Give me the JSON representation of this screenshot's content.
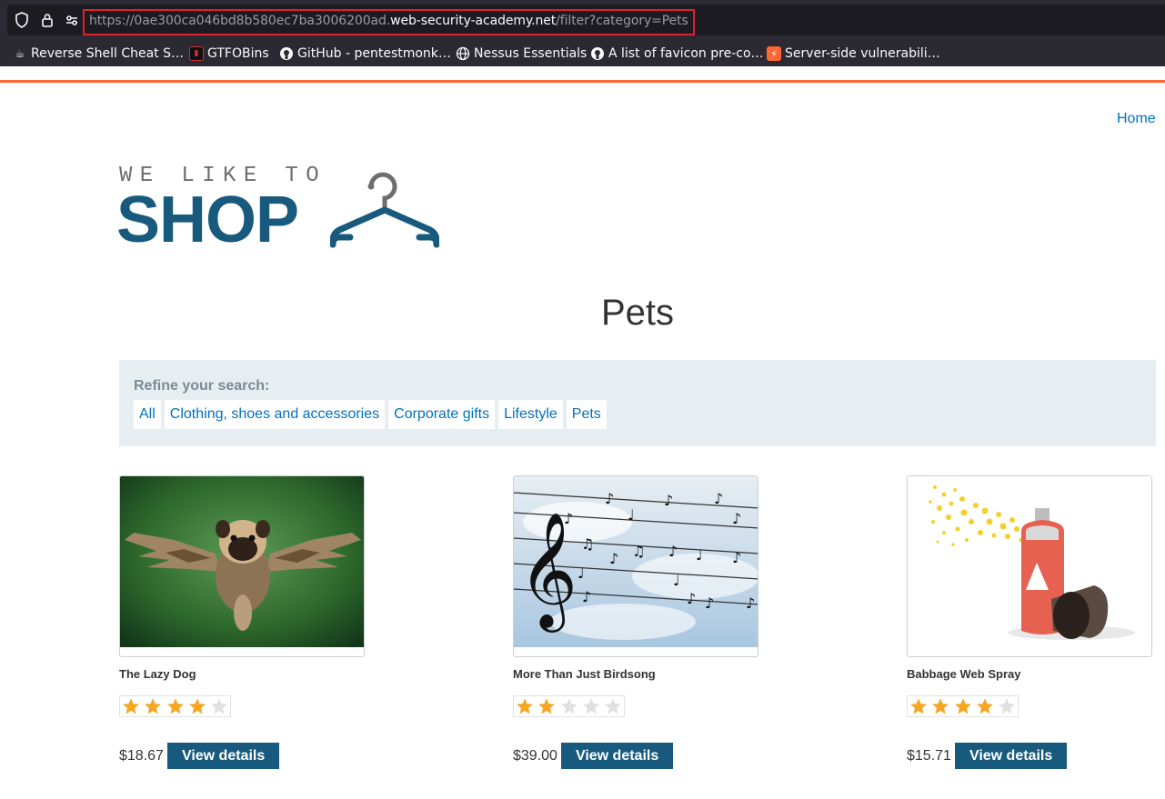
{
  "browser": {
    "url_prefix": "https://0ae300ca046bd8b580ec7ba3006200ad.",
    "url_host": "web-security-academy.net",
    "url_path": "/filter?category=Pets",
    "bookmarks": [
      {
        "label": "Reverse Shell Cheat S…",
        "icon": "cup-icon"
      },
      {
        "label": "GTFOBins",
        "icon": "gtfobins-icon"
      },
      {
        "label": "GitHub - pentestmonk…",
        "icon": "github-icon"
      },
      {
        "label": "Nessus Essentials",
        "icon": "globe-icon"
      },
      {
        "label": "A list of favicon pre-co…",
        "icon": "github-icon"
      },
      {
        "label": "Server-side vulnerabili…",
        "icon": "portswigger-icon"
      }
    ]
  },
  "header": {
    "home_label": "Home",
    "logo_top": "WE LIKE TO",
    "logo_bottom": "SHOP"
  },
  "page": {
    "heading": "Pets"
  },
  "filters": {
    "label": "Refine your search:",
    "items": [
      "All",
      "Clothing, shoes and accessories",
      "Corporate gifts",
      "Lifestyle",
      "Pets"
    ]
  },
  "products": [
    {
      "name": "The Lazy Dog",
      "price": "$18.67",
      "rating": 4,
      "button": "View details",
      "image": "flying-pug-image"
    },
    {
      "name": "More Than Just Birdsong",
      "price": "$39.00",
      "rating": 2,
      "button": "View details",
      "image": "birds-on-wires-music-image"
    },
    {
      "name": "Babbage Web Spray",
      "price": "$15.71",
      "rating": 4,
      "button": "View details",
      "image": "spray-can-image"
    }
  ],
  "colors": {
    "accent": "#ff6633",
    "brand": "#185a7d",
    "link": "#0071bc",
    "star_filled": "#f5a623",
    "star_empty": "#e0e0e0"
  }
}
